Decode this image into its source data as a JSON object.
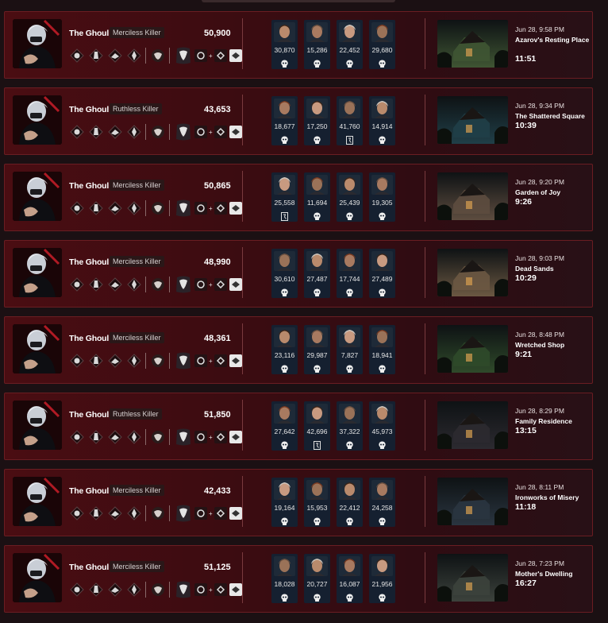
{
  "matches": [
    {
      "killer": "The Ghoul",
      "grade": "Merciless Killer",
      "score": "50,900",
      "survivors": [
        {
          "score": "30,870",
          "status": "skull"
        },
        {
          "score": "15,286",
          "status": "skull"
        },
        {
          "score": "22,452",
          "status": "skull"
        },
        {
          "score": "29,680",
          "status": "skull"
        }
      ],
      "date": "Jun 28, 9:58 PM",
      "map": "Azarov's Resting Place",
      "duration": "11:51",
      "map_color": "#3f5533"
    },
    {
      "killer": "The Ghoul",
      "grade": "Ruthless Killer",
      "score": "43,653",
      "survivors": [
        {
          "score": "18,677",
          "status": "skull"
        },
        {
          "score": "17,250",
          "status": "skull"
        },
        {
          "score": "41,760",
          "status": "escape"
        },
        {
          "score": "14,914",
          "status": "skull"
        }
      ],
      "date": "Jun 28, 9:34 PM",
      "map": "The Shattered Square",
      "duration": "10:39",
      "map_color": "#203f48"
    },
    {
      "killer": "The Ghoul",
      "grade": "Merciless Killer",
      "score": "50,865",
      "survivors": [
        {
          "score": "25,558",
          "status": "escape"
        },
        {
          "score": "11,694",
          "status": "skull"
        },
        {
          "score": "25,439",
          "status": "skull"
        },
        {
          "score": "19,305",
          "status": "skull"
        }
      ],
      "date": "Jun 28, 9:20 PM",
      "map": "Garden of Joy",
      "duration": "9:26",
      "map_color": "#5d4c3f"
    },
    {
      "killer": "The Ghoul",
      "grade": "Merciless Killer",
      "score": "48,990",
      "survivors": [
        {
          "score": "30,610",
          "status": "skull"
        },
        {
          "score": "27,487",
          "status": "skull"
        },
        {
          "score": "17,744",
          "status": "skull"
        },
        {
          "score": "27,489",
          "status": "skull"
        }
      ],
      "date": "Jun 28, 9:03 PM",
      "map": "Dead Sands",
      "duration": "10:29",
      "map_color": "#6b5842"
    },
    {
      "killer": "The Ghoul",
      "grade": "Merciless Killer",
      "score": "48,361",
      "survivors": [
        {
          "score": "23,116",
          "status": "skull"
        },
        {
          "score": "29,987",
          "status": "skull"
        },
        {
          "score": "7,827",
          "status": "skull"
        },
        {
          "score": "18,941",
          "status": "skull"
        }
      ],
      "date": "Jun 28, 8:48 PM",
      "map": "Wretched Shop",
      "duration": "9:21",
      "map_color": "#2f4a2a"
    },
    {
      "killer": "The Ghoul",
      "grade": "Ruthless Killer",
      "score": "51,850",
      "survivors": [
        {
          "score": "27,642",
          "status": "skull"
        },
        {
          "score": "42,696",
          "status": "escape"
        },
        {
          "score": "37,322",
          "status": "skull"
        },
        {
          "score": "45,973",
          "status": "skull"
        }
      ],
      "date": "Jun 28, 8:29 PM",
      "map": "Family Residence",
      "duration": "13:15",
      "map_color": "#2c2a30"
    },
    {
      "killer": "The Ghoul",
      "grade": "Merciless Killer",
      "score": "42,433",
      "survivors": [
        {
          "score": "19,164",
          "status": "skull"
        },
        {
          "score": "15,953",
          "status": "skull"
        },
        {
          "score": "22,412",
          "status": "skull"
        },
        {
          "score": "24,258",
          "status": "skull"
        }
      ],
      "date": "Jun 28, 8:11 PM",
      "map": "Ironworks of Misery",
      "duration": "11:18",
      "map_color": "#2a3540"
    },
    {
      "killer": "The Ghoul",
      "grade": "Merciless Killer",
      "score": "51,125",
      "survivors": [
        {
          "score": "18,028",
          "status": "skull"
        },
        {
          "score": "20,727",
          "status": "skull"
        },
        {
          "score": "16,087",
          "status": "skull"
        },
        {
          "score": "21,956",
          "status": "skull"
        }
      ],
      "date": "Jun 28, 7:23 PM",
      "map": "Mother's Dwelling",
      "duration": "16:27",
      "map_color": "#3c423c"
    }
  ],
  "colors": {
    "card_border": "#6a1d22",
    "card_bg": "#3b0c11",
    "survivor_tile": "#152030",
    "grade_bg": "#2a1718"
  }
}
